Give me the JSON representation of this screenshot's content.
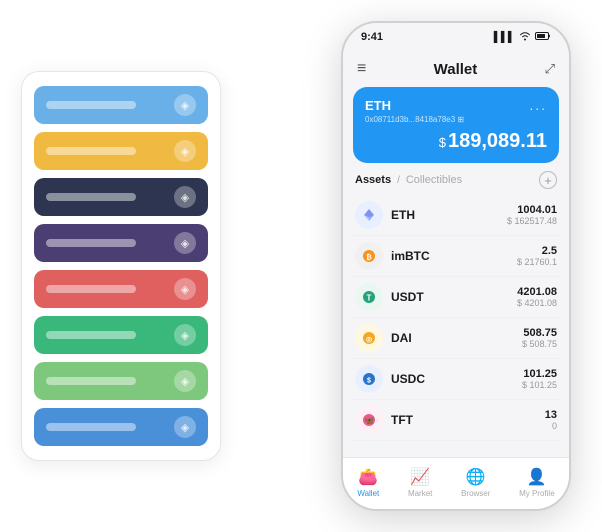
{
  "scene": {
    "cardStack": {
      "rows": [
        {
          "color": "#6ab0e8",
          "iconText": "◈"
        },
        {
          "color": "#f0b942",
          "iconText": "◈"
        },
        {
          "color": "#2d3550",
          "iconText": "◈"
        },
        {
          "color": "#4b3e72",
          "iconText": "◈"
        },
        {
          "color": "#e06060",
          "iconText": "◈"
        },
        {
          "color": "#3ab87c",
          "iconText": "◈"
        },
        {
          "color": "#7ec87e",
          "iconText": "◈"
        },
        {
          "color": "#4a90d9",
          "iconText": "◈"
        }
      ]
    },
    "phone": {
      "statusBar": {
        "time": "9:41",
        "signal": "▌▌▌",
        "wifi": "WiFi",
        "battery": "🔋"
      },
      "header": {
        "menuIcon": "≡",
        "title": "Wallet",
        "expandIcon": "⤢"
      },
      "ethCard": {
        "label": "ETH",
        "address": "0x08711d3b...8418a78e3 ⊞",
        "dotsMenu": "...",
        "dollarSign": "$",
        "balance": "189,089.11"
      },
      "assetsSection": {
        "activeTab": "Assets",
        "separator": "/",
        "inactiveTab": "Collectibles",
        "addIcon": "+"
      },
      "assets": [
        {
          "name": "ETH",
          "iconEmoji": "♦",
          "iconBg": "#e8f0ff",
          "iconColor": "#627eea",
          "amount": "1004.01",
          "usd": "$ 162517.48"
        },
        {
          "name": "imBTC",
          "iconEmoji": "⊙",
          "iconBg": "#f0f0f0",
          "iconColor": "#f7931a",
          "amount": "2.5",
          "usd": "$ 21760.1"
        },
        {
          "name": "USDT",
          "iconEmoji": "T",
          "iconBg": "#e8f8f0",
          "iconColor": "#26a17b",
          "amount": "4201.08",
          "usd": "$ 4201.08"
        },
        {
          "name": "DAI",
          "iconEmoji": "◎",
          "iconBg": "#fff8e0",
          "iconColor": "#f5a623",
          "amount": "508.75",
          "usd": "$ 508.75"
        },
        {
          "name": "USDC",
          "iconEmoji": "$",
          "iconBg": "#e8f0ff",
          "iconColor": "#2775ca",
          "amount": "101.25",
          "usd": "$ 101.25"
        },
        {
          "name": "TFT",
          "iconEmoji": "🦋",
          "iconBg": "#fff0f5",
          "iconColor": "#e85d8a",
          "amount": "13",
          "usd": "0"
        }
      ],
      "nav": [
        {
          "icon": "👛",
          "label": "Wallet",
          "active": true
        },
        {
          "icon": "📈",
          "label": "Market",
          "active": false
        },
        {
          "icon": "🌐",
          "label": "Browser",
          "active": false
        },
        {
          "icon": "👤",
          "label": "My Profile",
          "active": false
        }
      ]
    }
  }
}
